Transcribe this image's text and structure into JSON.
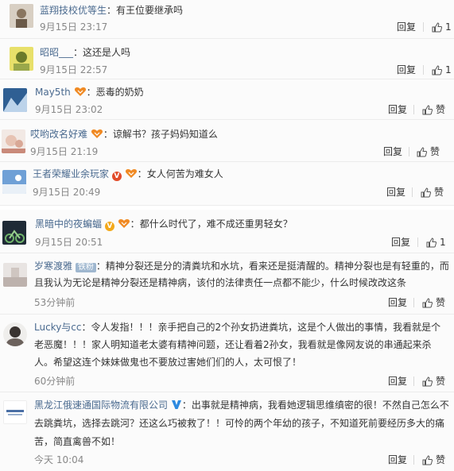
{
  "comments": [
    {
      "user": "蓝翔技校优等生",
      "sep": "：",
      "text": "有王位要继承吗",
      "time": "9月15日 23:17",
      "reply": "回复",
      "like": "1"
    },
    {
      "user": "昭昭___",
      "sep": "：",
      "text": "这还是人吗",
      "time": "9月15日 22:57",
      "reply": "回复",
      "like": "1"
    },
    {
      "user": "May5th",
      "sep": "：",
      "text": "恶毒的奶奶",
      "time": "9月15日 23:02",
      "reply": "回复",
      "like": "赞"
    },
    {
      "user": "哎哟改名好难",
      "sep": "：",
      "text": "谅解书？孩子妈妈知道么",
      "time": "9月15日 21:19",
      "reply": "回复",
      "like": "赞"
    },
    {
      "user": "王者荣耀业余玩家",
      "sep": "：",
      "text": "女人何苦为难女人",
      "time": "9月15日 20:49",
      "reply": "回复",
      "like": "赞"
    },
    {
      "user": "黑暗中的夜蝙蝠",
      "sep": "：",
      "text": "都什么时代了，难不成还重男轻女？",
      "time": "9月15日 20:51",
      "reply": "回复",
      "like": "1"
    },
    {
      "user": "岁寒渡雅",
      "tag": "铁粉",
      "sep": "：",
      "text": "精神分裂还是分的清粪坑和水坑，看来还是挺清醒的。精神分裂也是有轻重的，而且我认为无论是精神分裂还是精神病，该付的法律责任一点都不能少，什么时候改改这条",
      "time": "53分钟前",
      "reply": "回复",
      "like": "赞"
    },
    {
      "user": "Lucky与cc",
      "sep": "：",
      "text": "令人发指！！！亲手把自己的2个孙女扔进粪坑，这是个人做出的事情，我看就是个老恶魔！！！家人明知道老太婆有精神问题，还让看着2孙女，我看就是像网友说的串通起来杀人。希望这连个妹妹做鬼也不要放过害她们们的人，太可恨了！",
      "time": "60分钟前",
      "reply": "回复",
      "like": "赞"
    },
    {
      "user": "黑龙江俄速通国际物流有限公司",
      "sep": "：",
      "text": "出事就是精神病，我看她逻辑思维缜密的很！不然自己怎么不去跳粪坑，选择去跳河？还这么巧被救了！！可怜的两个年幼的孩子，不知道死前要经历多大的痛苦，简直禽兽不如！",
      "time": "今天 10:04",
      "reply": "回复",
      "like": "赞"
    }
  ],
  "colors": {
    "username": "#4a6a8f",
    "time": "#888888",
    "background": "#fbfbfb"
  }
}
